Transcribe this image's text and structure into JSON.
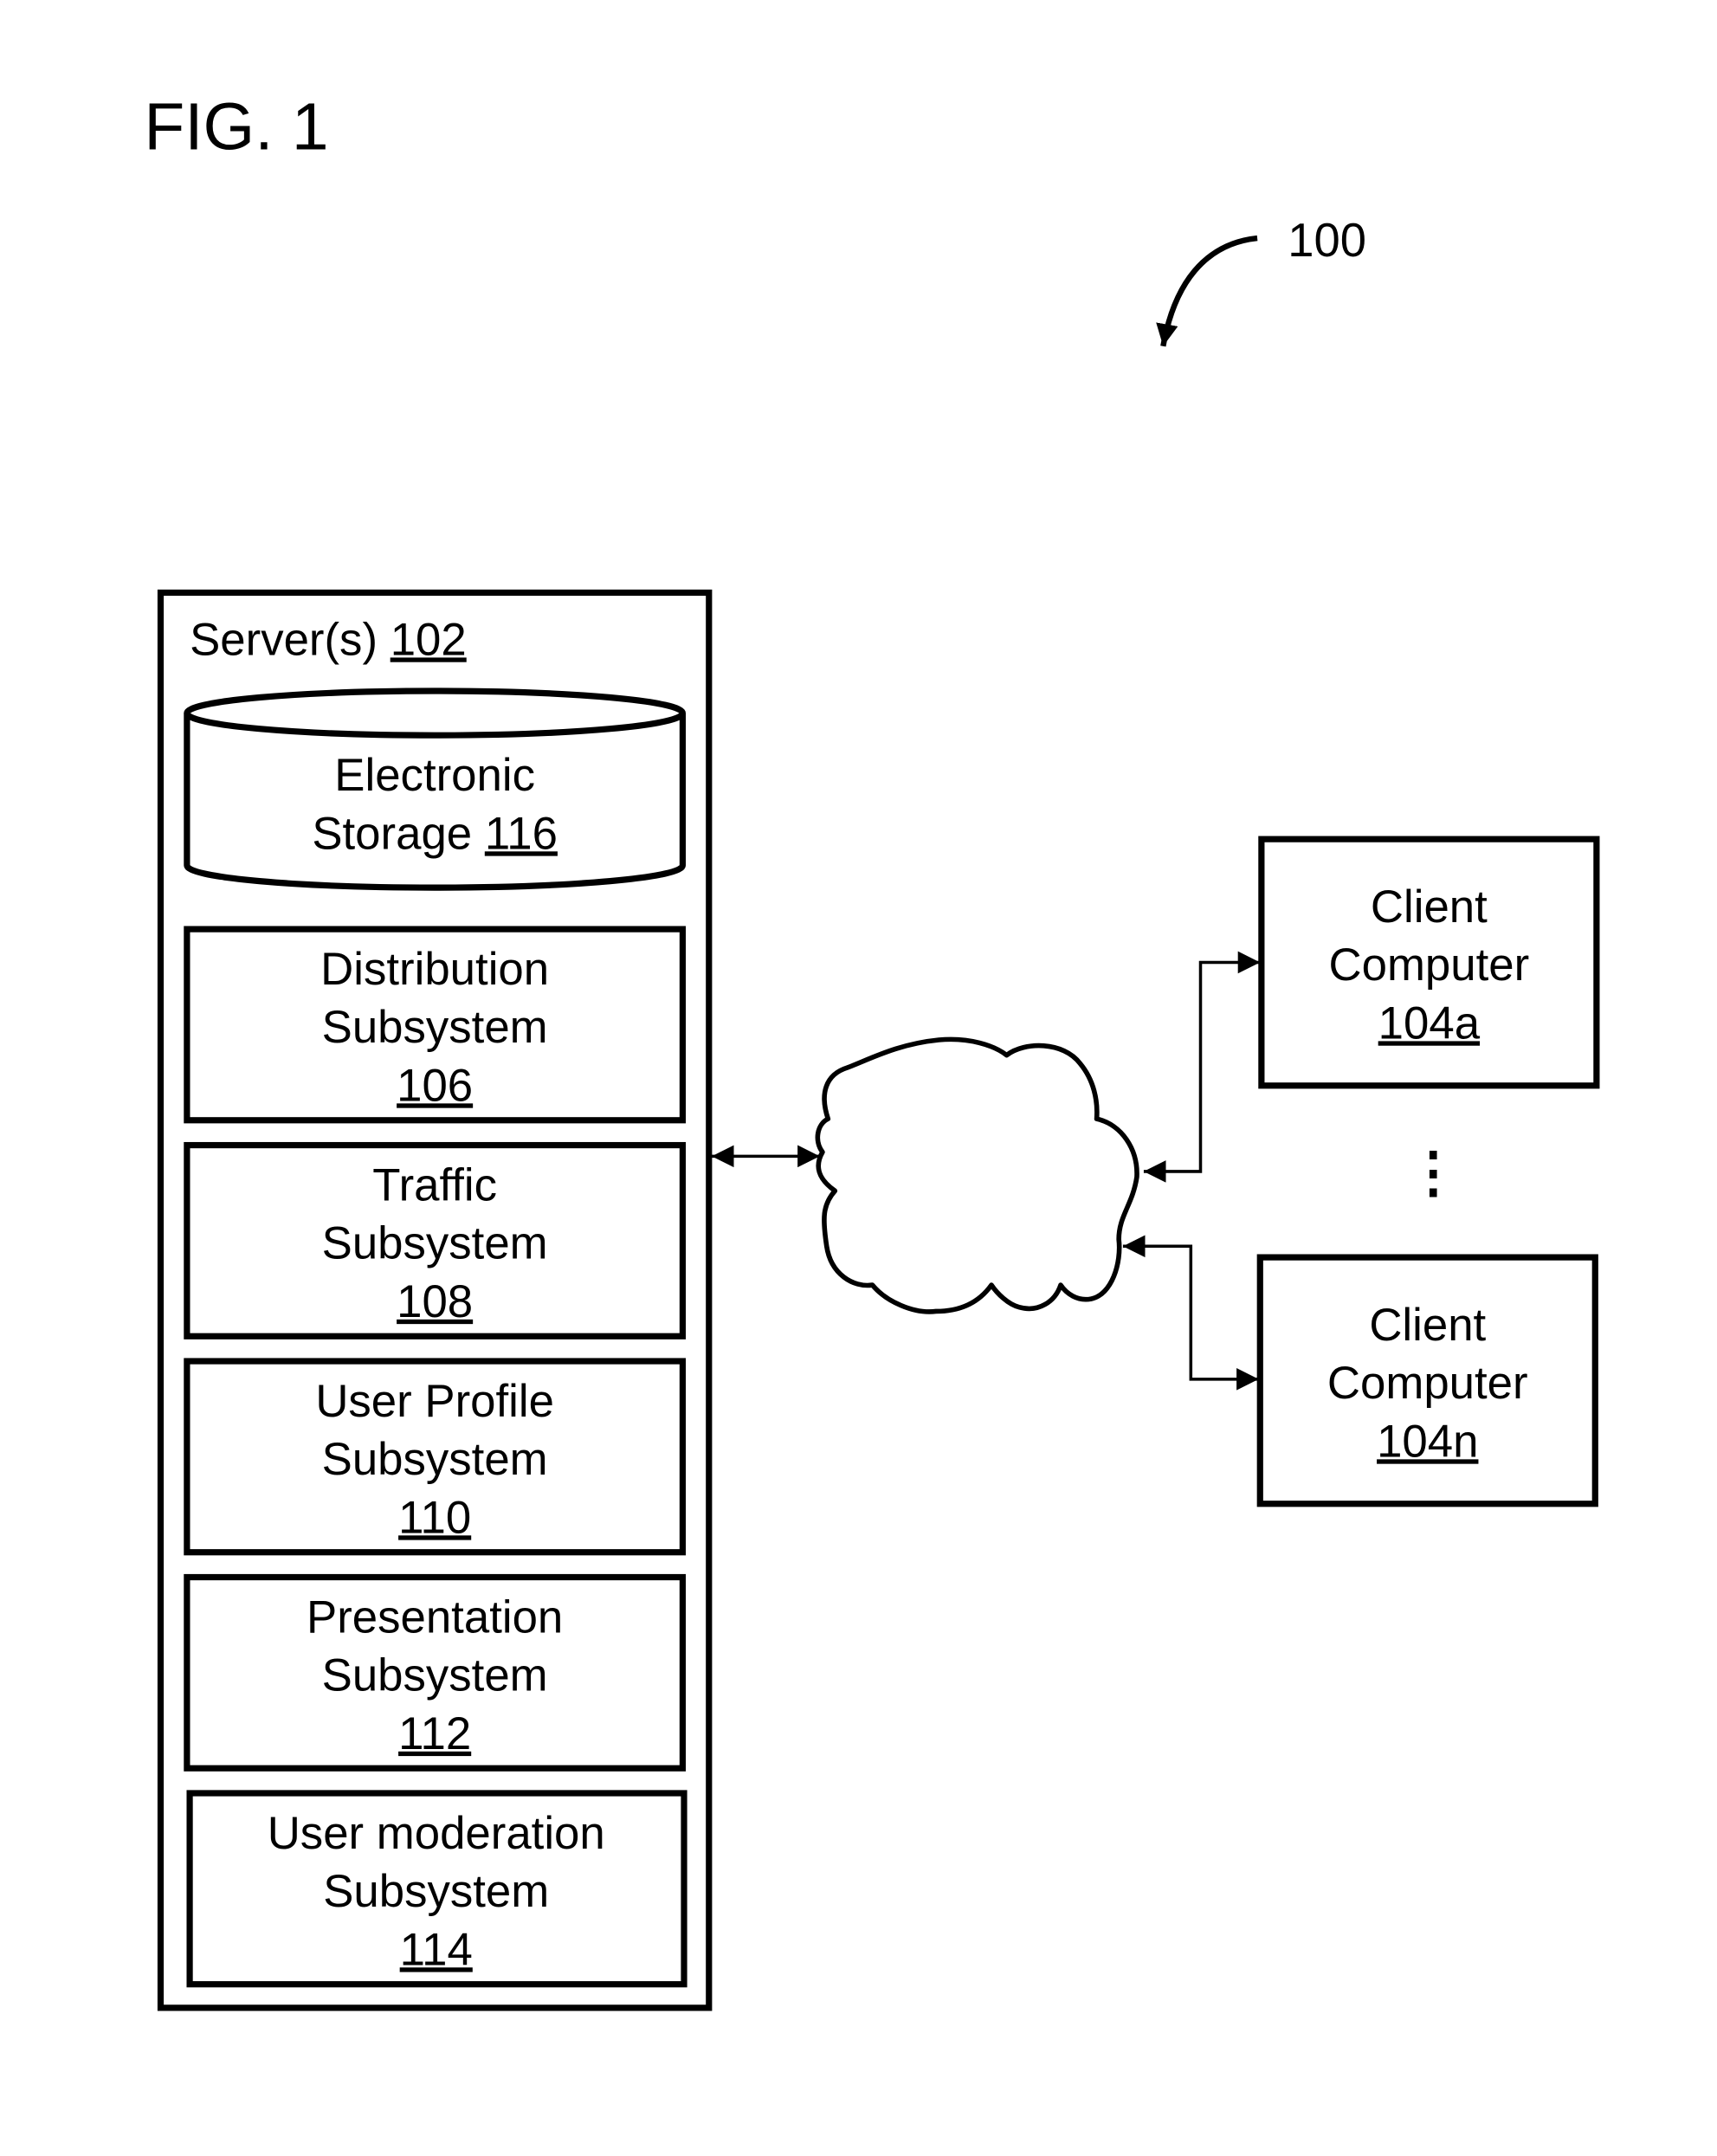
{
  "figure": {
    "title": "FIG. 1",
    "system_ref": "100"
  },
  "server": {
    "label": "Server(s)",
    "ref": "102",
    "storage": {
      "line1": "Electronic",
      "line2": "Storage",
      "ref": "116"
    },
    "subsystems": [
      {
        "line1": "Distribution",
        "line2": "Subsystem",
        "ref": "106"
      },
      {
        "line1": "Traffic",
        "line2": "Subsystem",
        "ref": "108"
      },
      {
        "line1": "User Profile",
        "line2": "Subsystem",
        "ref": "110"
      },
      {
        "line1": "Presentation",
        "line2": "Subsystem",
        "ref": "112"
      },
      {
        "line1": "User moderation",
        "line2": "Subsystem",
        "ref": "114"
      }
    ]
  },
  "network": {
    "shape": "cloud"
  },
  "clients": [
    {
      "line1": "Client",
      "line2": "Computer",
      "ref": "104a"
    },
    {
      "line1": "Client",
      "line2": "Computer",
      "ref": "104n"
    }
  ],
  "ellipsis": "⋮"
}
